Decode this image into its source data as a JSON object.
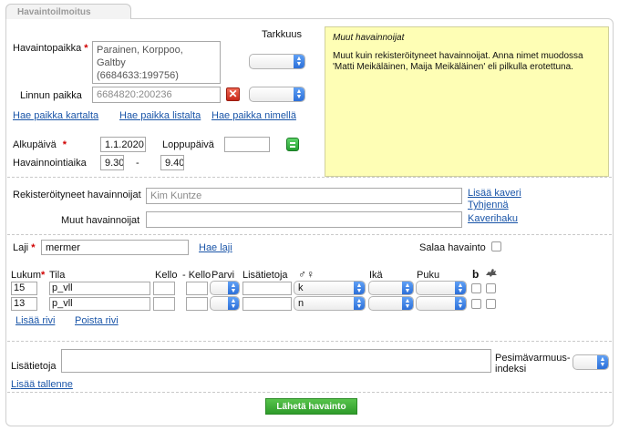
{
  "tab": {
    "title": "Havaintoilmoitus"
  },
  "location": {
    "label": "Havaintopaikka",
    "value_lines": [
      "Parainen, Korppoo,",
      "Galtby",
      "(6684633:199756)"
    ],
    "accuracy_label": "Tarkkuus",
    "bird_location_label": "Linnun paikka",
    "bird_location_value": "6684820:200236",
    "links": [
      "Hae paikka kartalta",
      "Hae paikka listalta",
      "Hae paikka nimellä"
    ]
  },
  "note": {
    "title": "Muut havainnoijat",
    "text": "Muut kuin rekisteröityneet havainnoijat. Anna nimet muodossa 'Matti Meikäläinen, Maija Meikäläinen' eli pilkulla erotettuna."
  },
  "dates": {
    "start_label": "Alkupäivä",
    "start_value": "1.1.2020",
    "end_label": "Loppupäivä",
    "end_value": "",
    "time_label": "Havainnointiaika",
    "time_start": "9.30",
    "time_dash": "-",
    "time_end": "9.40"
  },
  "observers": {
    "registered_label": "Rekisteröityneet havainnoijat",
    "registered_value": "Kim Kuntze",
    "add_friend": "Lisää kaveri",
    "clear": "Tyhjennä",
    "other_label": "Muut havainnoijat",
    "other_value": "",
    "friend_search": "Kaverihaku"
  },
  "species": {
    "label": "Laji",
    "value": "mermer",
    "search_link": "Hae laji",
    "hide_label": "Salaa havainto"
  },
  "table": {
    "headers": {
      "count": "Lukum",
      "state": "Tila",
      "clock": "Kello",
      "clock_to": "- Kello",
      "flock": "Parvi",
      "extra": "Lisätietoja",
      "sex_icon": "♂♀",
      "age": "Ikä",
      "plumage": "Puku",
      "breeding_icon": "b"
    },
    "rows": [
      {
        "count": "15",
        "state": "p_vll",
        "sex": "k"
      },
      {
        "count": "13",
        "state": "p_vll",
        "sex": "n"
      }
    ],
    "add_row": "Lisää rivi",
    "remove_row": "Poista rivi"
  },
  "footer": {
    "extra_label": "Lisätietoja",
    "extra_value": "",
    "breeding_label_1": "Pesimävarmuus-",
    "breeding_label_2": "indeksi",
    "save_link": "Lisää tallenne",
    "submit": "Lähetä havainto"
  },
  "colors": {
    "note_bg": "#fefeb5",
    "link": "#1a55a8",
    "submit": "#3aa832",
    "required": "#d00000"
  }
}
